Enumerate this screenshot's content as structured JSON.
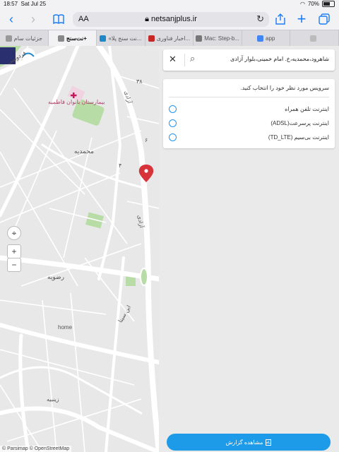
{
  "status_bar": {
    "time": "18:57",
    "date": "Sat Jul 25",
    "battery": "70%"
  },
  "browser": {
    "url_host": "netsanjplus.ir",
    "text_size_label": "AA",
    "tabs": [
      {
        "label": "جزئیات سام",
        "icon": "page-icon"
      },
      {
        "label": "نت‌سنج+",
        "icon": "close-icon",
        "active": true
      },
      {
        "label": "«نت سنج پلا...",
        "icon": "netsanj-icon"
      },
      {
        "label": "اخبار فناوری...",
        "icon": "news-icon"
      },
      {
        "label": "Mac: Step-b...",
        "icon": "doc-icon"
      },
      {
        "label": "app",
        "icon": "google-icon"
      },
      {
        "label": "",
        "icon": "blank-icon"
      }
    ]
  },
  "map": {
    "labels": {
      "ferdowsi": "فردوسی",
      "hospital": "بیمارستان بانوان فاطمیه",
      "azadi_top": "آزادی",
      "azadi_mid": "آزادی",
      "mohammadieh": "محمدیه",
      "razavieh": "رضویه",
      "home": "home",
      "zinabieh": "زینبیه",
      "ibnsina": "ابن سینا",
      "num_38": "۳۸",
      "num_4": "۴",
      "num_6": "۶"
    },
    "attribution": "© Parsimap © OpenStreetMap",
    "zoom_in": "+",
    "zoom_out": "−"
  },
  "search": {
    "query": "شاهرود،محمدیه،خ. امام خمینی،بلوار آزادی"
  },
  "service": {
    "prompt": "سرویس مورد نظر خود را انتخاب کنید.",
    "options": [
      "اینترنت تلفن همراه",
      "اینترنت پرسرعت(ADSL)",
      "اینترنت بی‌سیم (TD_LTE)"
    ]
  },
  "report_button": {
    "label": "مشاهده گزارش"
  },
  "colors": {
    "accent": "#1e9be8",
    "marker": "#d7333b",
    "park": "#b8dca6"
  }
}
